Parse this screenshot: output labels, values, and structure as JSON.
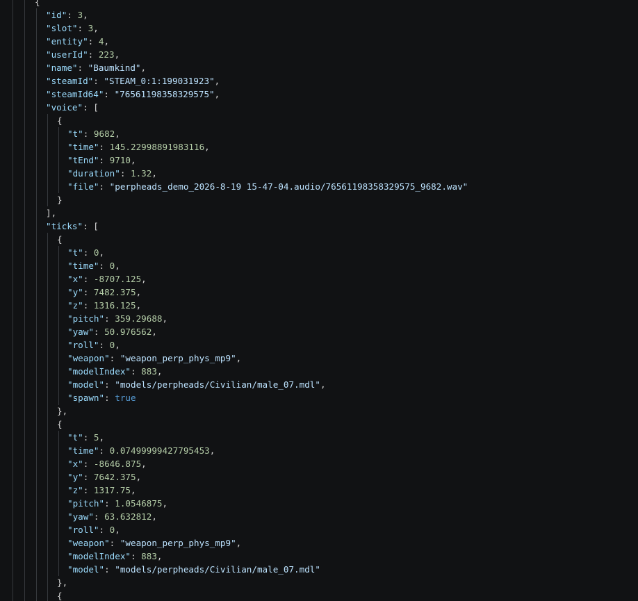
{
  "editor": {
    "content": "json",
    "lines": [
      {
        "indent": 1,
        "tokens": [
          {
            "t": "p",
            "v": "{"
          }
        ]
      },
      {
        "indent": 2,
        "key": "\"id\"",
        "value": "3",
        "vtype": "n",
        "trail": ","
      },
      {
        "indent": 2,
        "key": "\"slot\"",
        "value": "3",
        "vtype": "n",
        "trail": ","
      },
      {
        "indent": 2,
        "key": "\"entity\"",
        "value": "4",
        "vtype": "n",
        "trail": ","
      },
      {
        "indent": 2,
        "key": "\"userId\"",
        "value": "223",
        "vtype": "n",
        "trail": ","
      },
      {
        "indent": 2,
        "key": "\"name\"",
        "value": "\"Baumkind\"",
        "vtype": "str",
        "trail": ","
      },
      {
        "indent": 2,
        "key": "\"steamId\"",
        "value": "\"STEAM_0:1:199031923\"",
        "vtype": "str",
        "trail": ","
      },
      {
        "indent": 2,
        "key": "\"steamId64\"",
        "value": "\"76561198358329575\"",
        "vtype": "str",
        "trail": ","
      },
      {
        "indent": 2,
        "key": "\"voice\"",
        "value": "[",
        "vtype": "p",
        "trail": ""
      },
      {
        "indent": 3,
        "tokens": [
          {
            "t": "p",
            "v": "{"
          }
        ]
      },
      {
        "indent": 4,
        "key": "\"t\"",
        "value": "9682",
        "vtype": "n",
        "trail": ","
      },
      {
        "indent": 4,
        "key": "\"time\"",
        "value": "145.22998891983116",
        "vtype": "n",
        "trail": ","
      },
      {
        "indent": 4,
        "key": "\"tEnd\"",
        "value": "9710",
        "vtype": "n",
        "trail": ","
      },
      {
        "indent": 4,
        "key": "\"duration\"",
        "value": "1.32",
        "vtype": "n",
        "trail": ","
      },
      {
        "indent": 4,
        "key": "\"file\"",
        "value": "\"perpheads_demo_2026-8-19 15-47-04.audio/76561198358329575_9682.wav\"",
        "vtype": "str",
        "trail": ""
      },
      {
        "indent": 3,
        "tokens": [
          {
            "t": "p",
            "v": "}"
          }
        ]
      },
      {
        "indent": 2,
        "tokens": [
          {
            "t": "p",
            "v": "],"
          }
        ]
      },
      {
        "indent": 2,
        "key": "\"ticks\"",
        "value": "[",
        "vtype": "p",
        "trail": ""
      },
      {
        "indent": 3,
        "tokens": [
          {
            "t": "p",
            "v": "{"
          }
        ]
      },
      {
        "indent": 4,
        "key": "\"t\"",
        "value": "0",
        "vtype": "n",
        "trail": ","
      },
      {
        "indent": 4,
        "key": "\"time\"",
        "value": "0",
        "vtype": "n",
        "trail": ","
      },
      {
        "indent": 4,
        "key": "\"x\"",
        "value": "-8707.125",
        "vtype": "n",
        "trail": ","
      },
      {
        "indent": 4,
        "key": "\"y\"",
        "value": "7482.375",
        "vtype": "n",
        "trail": ","
      },
      {
        "indent": 4,
        "key": "\"z\"",
        "value": "1316.125",
        "vtype": "n",
        "trail": ","
      },
      {
        "indent": 4,
        "key": "\"pitch\"",
        "value": "359.29688",
        "vtype": "n",
        "trail": ","
      },
      {
        "indent": 4,
        "key": "\"yaw\"",
        "value": "50.976562",
        "vtype": "n",
        "trail": ","
      },
      {
        "indent": 4,
        "key": "\"roll\"",
        "value": "0",
        "vtype": "n",
        "trail": ","
      },
      {
        "indent": 4,
        "key": "\"weapon\"",
        "value": "\"weapon_perp_phys_mp9\"",
        "vtype": "str",
        "trail": ","
      },
      {
        "indent": 4,
        "key": "\"modelIndex\"",
        "value": "883",
        "vtype": "n",
        "trail": ","
      },
      {
        "indent": 4,
        "key": "\"model\"",
        "value": "\"models/perpheads/Civilian/male_07.mdl\"",
        "vtype": "str",
        "trail": ","
      },
      {
        "indent": 4,
        "key": "\"spawn\"",
        "value": "true",
        "vtype": "b",
        "trail": ""
      },
      {
        "indent": 3,
        "tokens": [
          {
            "t": "p",
            "v": "},"
          }
        ]
      },
      {
        "indent": 3,
        "tokens": [
          {
            "t": "p",
            "v": "{"
          }
        ]
      },
      {
        "indent": 4,
        "key": "\"t\"",
        "value": "5",
        "vtype": "n",
        "trail": ","
      },
      {
        "indent": 4,
        "key": "\"time\"",
        "value": "0.07499999427795453",
        "vtype": "n",
        "trail": ","
      },
      {
        "indent": 4,
        "key": "\"x\"",
        "value": "-8646.875",
        "vtype": "n",
        "trail": ","
      },
      {
        "indent": 4,
        "key": "\"y\"",
        "value": "7642.375",
        "vtype": "n",
        "trail": ","
      },
      {
        "indent": 4,
        "key": "\"z\"",
        "value": "1317.75",
        "vtype": "n",
        "trail": ","
      },
      {
        "indent": 4,
        "key": "\"pitch\"",
        "value": "1.0546875",
        "vtype": "n",
        "trail": ","
      },
      {
        "indent": 4,
        "key": "\"yaw\"",
        "value": "63.632812",
        "vtype": "n",
        "trail": ","
      },
      {
        "indent": 4,
        "key": "\"roll\"",
        "value": "0",
        "vtype": "n",
        "trail": ","
      },
      {
        "indent": 4,
        "key": "\"weapon\"",
        "value": "\"weapon_perp_phys_mp9\"",
        "vtype": "str",
        "trail": ","
      },
      {
        "indent": 4,
        "key": "\"modelIndex\"",
        "value": "883",
        "vtype": "n",
        "trail": ","
      },
      {
        "indent": 4,
        "key": "\"model\"",
        "value": "\"models/perpheads/Civilian/male_07.mdl\"",
        "vtype": "str",
        "trail": ""
      },
      {
        "indent": 3,
        "tokens": [
          {
            "t": "p",
            "v": "},"
          }
        ]
      },
      {
        "indent": 3,
        "tokens": [
          {
            "t": "p",
            "v": "{"
          }
        ]
      }
    ]
  },
  "colors": {
    "background": "#111214",
    "key": "#9cdcfe",
    "string": "#bde3ff",
    "number": "#b5cea8",
    "boolean": "#569cd6",
    "punctuation": "#d4d4d4",
    "indent_guide": "#36393d"
  }
}
